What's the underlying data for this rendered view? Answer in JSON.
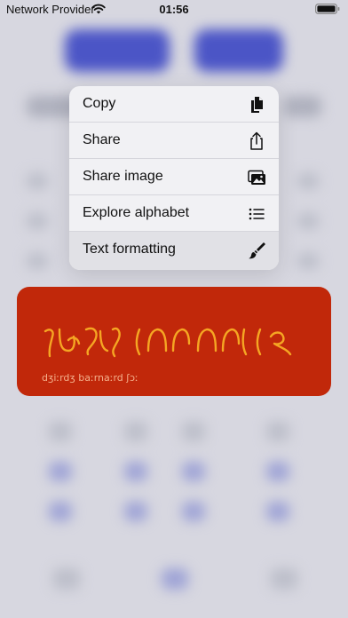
{
  "status_bar": {
    "carrier": "Network Provider",
    "time": "01:56",
    "icons": [
      "wifi-icon",
      "battery-icon"
    ]
  },
  "context_menu": {
    "items": [
      {
        "label": "Copy",
        "icon": "copy-icon"
      },
      {
        "label": "Share",
        "icon": "share-icon"
      },
      {
        "label": "Share image",
        "icon": "photo-icon"
      },
      {
        "label": "Explore alphabet",
        "icon": "list-icon"
      },
      {
        "label": "Text formatting",
        "icon": "paintbrush-icon"
      }
    ],
    "highlighted_item": "Text formatting"
  },
  "preview_card": {
    "transcription": "dʒiːrdʒ baːrnaːrd ʃɔː",
    "background": "#c1280a",
    "glyph_color": "#f5a623"
  }
}
